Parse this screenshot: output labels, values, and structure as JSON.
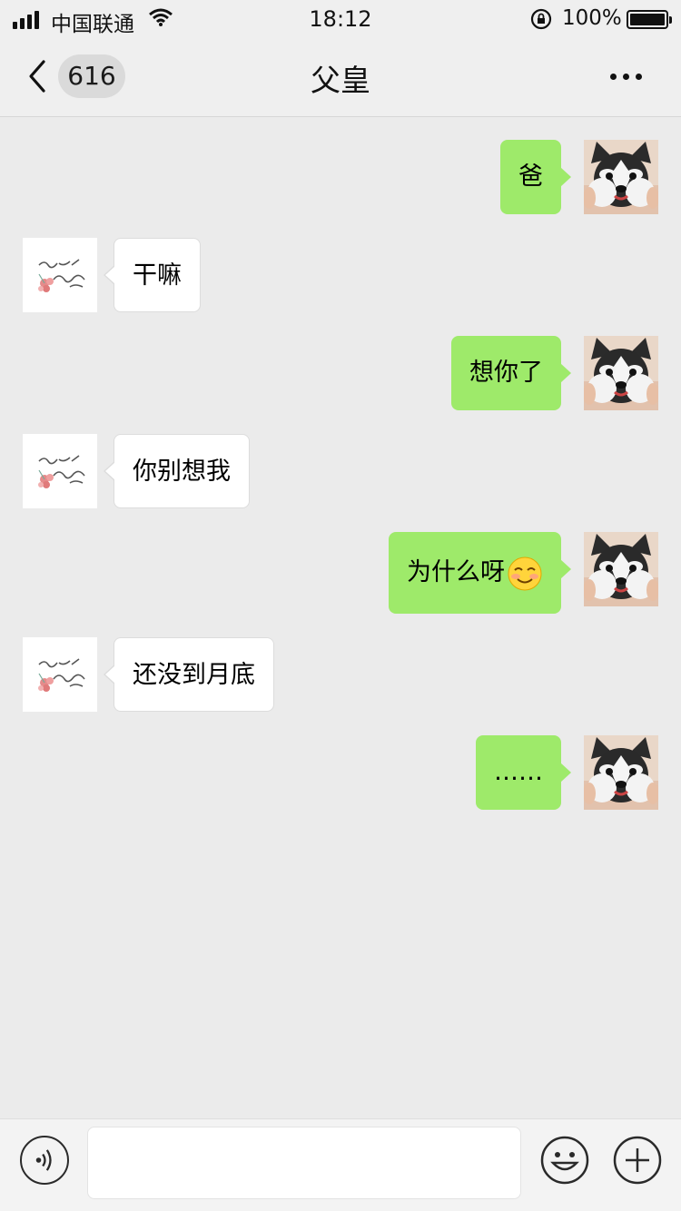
{
  "status_bar": {
    "carrier": "中国联通",
    "time": "18:12",
    "battery": "100%"
  },
  "nav": {
    "unread_count": "616",
    "title": "父皇"
  },
  "messages": [
    {
      "from": "me",
      "text": "爸"
    },
    {
      "from": "them",
      "text": "干嘛"
    },
    {
      "from": "me",
      "text": "想你了"
    },
    {
      "from": "them",
      "text": "你别想我"
    },
    {
      "from": "me",
      "text": "为什么呀",
      "emoji": "smiling-blush-emoji"
    },
    {
      "from": "them",
      "text": "还没到月底"
    },
    {
      "from": "me",
      "text": "……"
    }
  ],
  "input": {
    "value": "",
    "placeholder": ""
  },
  "colors": {
    "my_bubble": "#9eea6a",
    "their_bubble": "#ffffff",
    "background": "#ebebeb"
  }
}
